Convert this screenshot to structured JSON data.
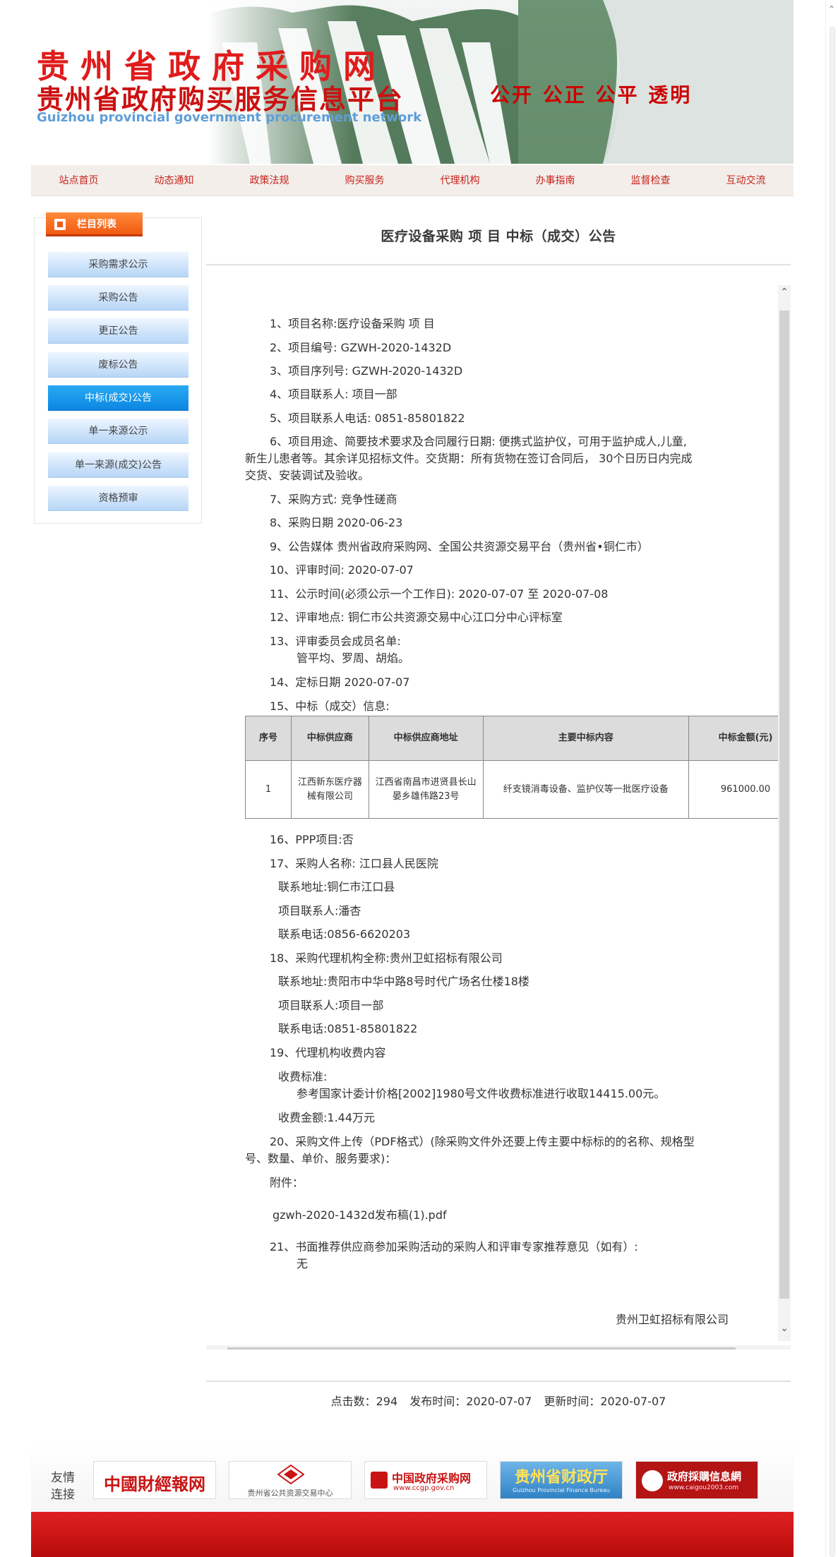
{
  "header": {
    "title_cn": "贵州省政府采购网",
    "subtitle_cn": "贵州省政府购买服务信息平台",
    "title_en": "Guizhou provincial government procurement network",
    "slogan": "公开 公正 公平 透明"
  },
  "nav": {
    "items": [
      "站点首页",
      "动态通知",
      "政策法规",
      "购买服务",
      "代理机构",
      "办事指南",
      "监督检查",
      "互动交流"
    ]
  },
  "sidebar": {
    "title": "栏目列表",
    "items": [
      "采购需求公示",
      "采购公告",
      "更正公告",
      "废标公告",
      "中标(成交)公告",
      "单一来源公示",
      "单一来源(成交)公告",
      "资格预审"
    ],
    "active_index": 4
  },
  "article": {
    "title": "医疗设备采购 项 目  中标（成交）公告",
    "lines": {
      "l1": "1、项目名称:医疗设备采购 项 目",
      "l2": "2、项目编号: GZWH-2020-1432D",
      "l3": "3、项目序列号: GZWH-2020-1432D",
      "l4": "4、项目联系人: 项目一部",
      "l5": "5、项目联系人电话: 0851-85801822",
      "l6a": "6、项目用途、简要技术要求及合同履行日期: 便携式监护仪，可用于监护成人,儿童,",
      "l6b": "新生儿患者等。其余详见招标文件。交货期：所有货物在签订合同后， 30个日历日内完成",
      "l6c": "交货、安装调试及验收。",
      "l7": "7、采购方式: 竞争性磋商",
      "l8": "8、采购日期 2020-06-23",
      "l9": "9、公告媒体 贵州省政府采购网、全国公共资源交易平台（贵州省•铜仁市）",
      "l10": "10、评审时间: 2020-07-07",
      "l11": "11、公示时间(必须公示一个工作日): 2020-07-07  至  2020-07-08",
      "l12": "12、评审地点: 铜仁市公共资源交易中心江口分中心评标室",
      "l13a": "13、评审委员会成员名单:",
      "l13b": "管平均、罗周、胡焰。",
      "l14": "14、定标日期 2020-07-07",
      "l15": "15、中标（成交）信息:",
      "l16": "16、PPP项目:否",
      "l17": "17、采购人名称: 江口县人民医院",
      "l17a": "联系地址:铜仁市江口县",
      "l17b": "项目联系人:潘杏",
      "l17c": "联系电话:0856-6620203",
      "l18": "18、采购代理机构全称:贵州卫虹招标有限公司",
      "l18a": "联系地址:贵阳市中华中路8号时代广场名仕楼18楼",
      "l18b": "项目联系人:项目一部",
      "l18c": "联系电话:0851-85801822",
      "l19": "19、代理机构收费内容",
      "l19a": "收费标准:",
      "l19b": "参考国家计委计价格[2002]1980号文件收费标准进行收取14415.00元。",
      "l19c": "收费金额:1.44万元",
      "l20a": "20、采购文件上传（PDF格式）(除采购文件外还要上传主要中标标的的名称、规格型",
      "l20b": "号、数量、单价、服务要求)：",
      "l20c": "附件：",
      "attachment": "gzwh-2020-1432d发布稿(1).pdf",
      "l21a": "21、书面推荐供应商参加采购活动的采购人和评审专家推荐意见（如有）:",
      "l21b": "无"
    },
    "table": {
      "headers": [
        "序号",
        "中标供应商",
        "中标供应商地址",
        "主要中标内容",
        "中标金额(元)"
      ],
      "rows": [
        [
          "1",
          "江西新东医疗器械有限公司",
          "江西省南昌市进贤县长山晏乡雄伟路23号",
          "纤支镜消毒设备、监护仪等一批医疗设备",
          "961000.00"
        ]
      ]
    },
    "signature": "贵州卫虹招标有限公司"
  },
  "meta": {
    "clicks": "点击数：294",
    "published": "发布时间：2020-07-07",
    "updated": "更新时间：2020-07-07"
  },
  "links": {
    "label": "友情连接",
    "items": [
      "中國財經報网",
      "贵州省公共资源交易中心",
      "中国政府采购网",
      "贵州省财政厅",
      "政府採購信息網"
    ],
    "sub": [
      "",
      "",
      "www.ccgp.gov.cn",
      "Guizhou Provincial Finance Bureau",
      "www.caigou2003.com"
    ]
  },
  "colors": {
    "brand_red": "#e01b1b",
    "nav_text": "#c8241c",
    "active_blue": "#0c87e2",
    "sidebar_head": "#f15a12"
  }
}
